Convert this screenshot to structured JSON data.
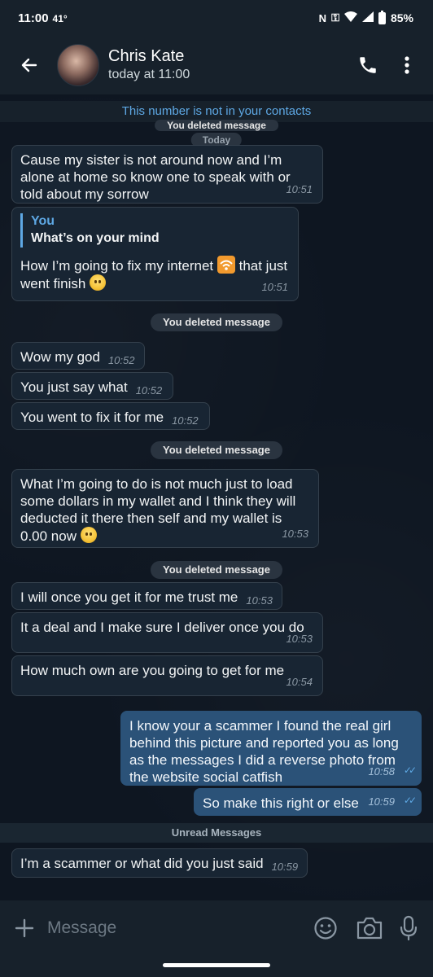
{
  "status_bar": {
    "time": "11:00",
    "temperature": "41°",
    "battery": "85%"
  },
  "header": {
    "contact_name": "Chris Kate",
    "last_seen": "today at 11:00"
  },
  "notice": "This number is not in your contacts",
  "pills": {
    "deleted_top": "You deleted message",
    "date_today": "Today",
    "deleted_1": "You deleted message",
    "deleted_2": "You deleted message",
    "deleted_3": "You deleted message"
  },
  "messages": [
    {
      "text": "Cause my sister is not around now and I’m alone at home so know one to speak with or told about my sorrow",
      "time": "10:51"
    },
    {
      "reply_author": "You",
      "reply_text": "What’s on your mind",
      "text_a": "How I’m going to fix my internet ",
      "text_b": " that just went finish ",
      "time": "10:51"
    },
    {
      "text": "Wow my god",
      "time": "10:52"
    },
    {
      "text": "You just say what",
      "time": "10:52"
    },
    {
      "text": "You went to fix it for me",
      "time": "10:52"
    },
    {
      "text": "What I’m going to do is not much just to load some dollars in my wallet and I think they will deducted it there then self and my wallet is 0.00 now ",
      "time": "10:53"
    },
    {
      "text": "I will once you get it for me trust me",
      "time": "10:53"
    },
    {
      "text": "It a deal and I make sure I deliver once you do",
      "time": "10:53"
    },
    {
      "text": "How much own are you going to get for me",
      "time": "10:54"
    },
    {
      "text": "I know your a scammer I found the real girl behind this picture and reported you as long as the messages I did a reverse photo from the website social catfish",
      "time": "10:58"
    },
    {
      "text": "So make this right or else",
      "time": "10:59"
    },
    {
      "text": "I’m a scammer or what did you just said",
      "time": "10:59"
    }
  ],
  "unread_label": "Unread Messages",
  "composer": {
    "placeholder": "Message"
  }
}
